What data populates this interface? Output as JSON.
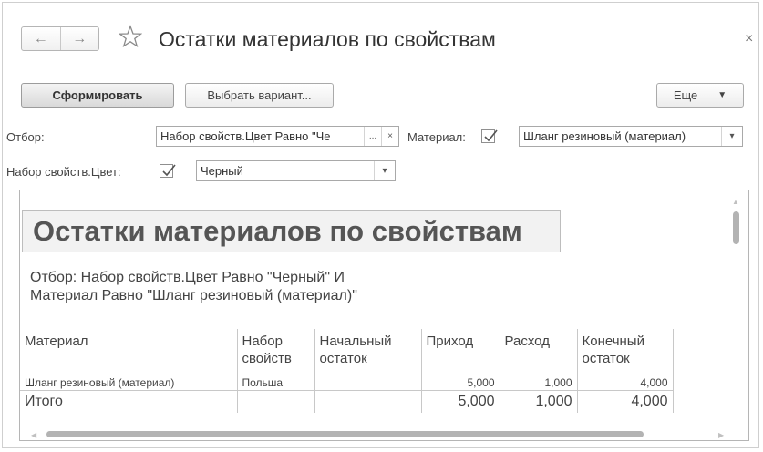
{
  "window": {
    "title": "Остатки материалов по свойствам",
    "back_icon": "←",
    "forward_icon": "→",
    "close_icon": "×"
  },
  "toolbar": {
    "generate_label": "Сформировать",
    "choose_variant_label": "Выбрать вариант...",
    "more_label": "Еще",
    "more_arrow": "▼"
  },
  "filters": {
    "selection_label": "Отбор:",
    "selection_value": "Набор свойств.Цвет Равно \"Че",
    "selection_dots": "...",
    "selection_clear": "×",
    "material_label": "Материал:",
    "material_checked": true,
    "material_value": "Шланг резиновый (материал)",
    "material_arrow": "▾",
    "color_label": "Набор свойств.Цвет:",
    "color_checked": true,
    "color_value": "Черный",
    "color_arrow": "▾"
  },
  "report": {
    "title": "Остатки материалов по свойствам",
    "filter_line1": "Отбор: Набор свойств.Цвет Равно \"Черный\" И",
    "filter_line2": "Материал Равно \"Шланг резиновый (материал)\"",
    "columns": [
      {
        "line1": "Материал",
        "line2": ""
      },
      {
        "line1": "Набор",
        "line2": "свойств"
      },
      {
        "line1": "Начальный",
        "line2": "остаток"
      },
      {
        "line1": "Приход",
        "line2": ""
      },
      {
        "line1": "Расход",
        "line2": ""
      },
      {
        "line1": "Конечный",
        "line2": "остаток"
      }
    ],
    "rows": [
      {
        "material": "Шланг резиновый (материал)",
        "set": "Польша",
        "start": "",
        "income": "5,000",
        "expense": "1,000",
        "end": "4,000"
      }
    ],
    "total": {
      "label": "Итого",
      "start": "",
      "income": "5,000",
      "expense": "1,000",
      "end": "4,000"
    }
  }
}
